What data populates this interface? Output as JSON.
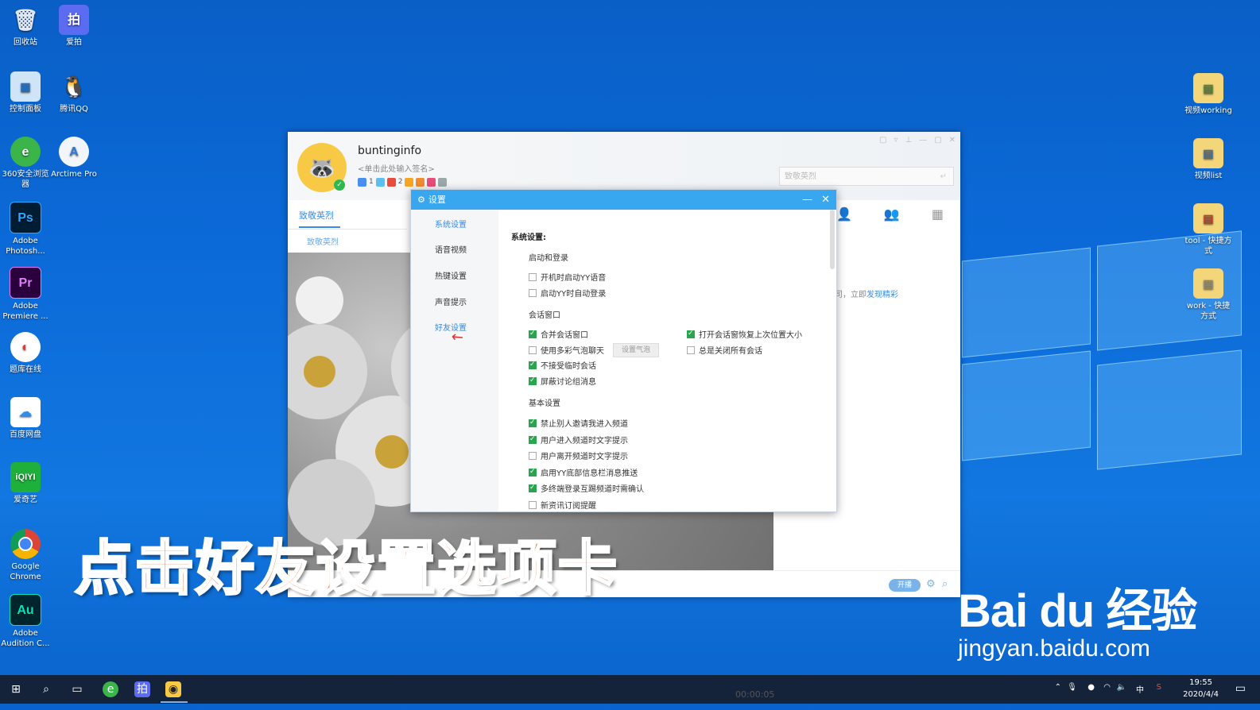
{
  "desktop": {
    "left_icons": [
      {
        "label": "回收站",
        "icon": "recycle-bin-icon"
      },
      {
        "label": "爱拍",
        "icon": "aipai-icon"
      },
      {
        "label": "控制面板",
        "icon": "control-panel-icon"
      },
      {
        "label": "腾讯QQ",
        "icon": "qq-icon"
      },
      {
        "label": "360安全浏览器",
        "icon": "browser-360-icon"
      },
      {
        "label": "Arctime Pro",
        "icon": "arctime-icon"
      },
      {
        "label": "Adobe Photosh...",
        "icon": "photoshop-icon",
        "glyph": "Ps"
      },
      {
        "label": "Adobe Premiere ...",
        "icon": "premiere-icon",
        "glyph": "Pr"
      },
      {
        "label": "题库在线",
        "icon": "tiku-icon"
      },
      {
        "label": "百度网盘",
        "icon": "baidu-netdisk-icon"
      },
      {
        "label": "爱奇艺",
        "icon": "iqiyi-icon",
        "glyph": "iQIYI"
      },
      {
        "label": "Google Chrome",
        "icon": "chrome-icon"
      },
      {
        "label": "Adobe Audition C...",
        "icon": "audition-icon",
        "glyph": "Au"
      }
    ],
    "right_icons": [
      {
        "label": "视频working",
        "icon": "folder-icon"
      },
      {
        "label": "视频list",
        "icon": "folder-icon"
      },
      {
        "label": "tool - 快捷方式",
        "icon": "folder-shortcut-icon"
      },
      {
        "label": "work - 快捷方式",
        "icon": "folder-shortcut-icon"
      }
    ]
  },
  "yy_window": {
    "username": "buntinginfo",
    "signature": "<单击此处输入签名>",
    "badge_counts": [
      "1",
      "2"
    ],
    "search_placeholder": "致敬英烈",
    "tab_label": "致敬英烈",
    "sub_label": "致敬英烈",
    "hint_text": "司，立即",
    "hint_link": "发现精彩",
    "kaibo_label": "开播"
  },
  "settings_dialog": {
    "title": "设置",
    "nav": [
      "系统设置",
      "语音视频",
      "热键设置",
      "声音提示",
      "好友设置"
    ],
    "section_title": "系统设置:",
    "groups": {
      "startup": {
        "title": "启动和登录",
        "options": [
          {
            "label": "开机时启动YY语音",
            "checked": false
          },
          {
            "label": "启动YY时自动登录",
            "checked": false
          }
        ]
      },
      "session": {
        "title": "会话窗口",
        "options_left": [
          {
            "label": "合并会话窗口",
            "checked": true
          },
          {
            "label": "使用多彩气泡聊天",
            "checked": false
          },
          {
            "label": "不接受临时会话",
            "checked": true
          },
          {
            "label": "屏蔽讨论组消息",
            "checked": true
          }
        ],
        "options_right": [
          {
            "label": "打开会话窗恢复上次位置大小",
            "checked": true
          },
          {
            "label": "总是关闭所有会话",
            "checked": false
          }
        ],
        "bubble_button": "设置气泡"
      },
      "basic": {
        "title": "基本设置",
        "options": [
          {
            "label": "禁止别人邀请我进入频道",
            "checked": true
          },
          {
            "label": "用户进入频道时文字提示",
            "checked": true
          },
          {
            "label": "用户离开频道时文字提示",
            "checked": false
          },
          {
            "label": "启用YY底部信息栏消息推送",
            "checked": true
          },
          {
            "label": "多终端登录互踢频道时需确认",
            "checked": true
          },
          {
            "label": "新资讯订阅提醒",
            "checked": false
          }
        ]
      }
    }
  },
  "caption": "点击好友设置选项卡",
  "watermark": {
    "logo": "Bai du 经验",
    "url": "jingyan.baidu.com"
  },
  "taskbar": {
    "time": "19:55",
    "date": "2020/4/4",
    "ime": "中",
    "timecode": "00:00:05"
  },
  "colors": {
    "accent": "#39a6f0",
    "check": "#2ba44f",
    "caption": "#e06b33"
  }
}
